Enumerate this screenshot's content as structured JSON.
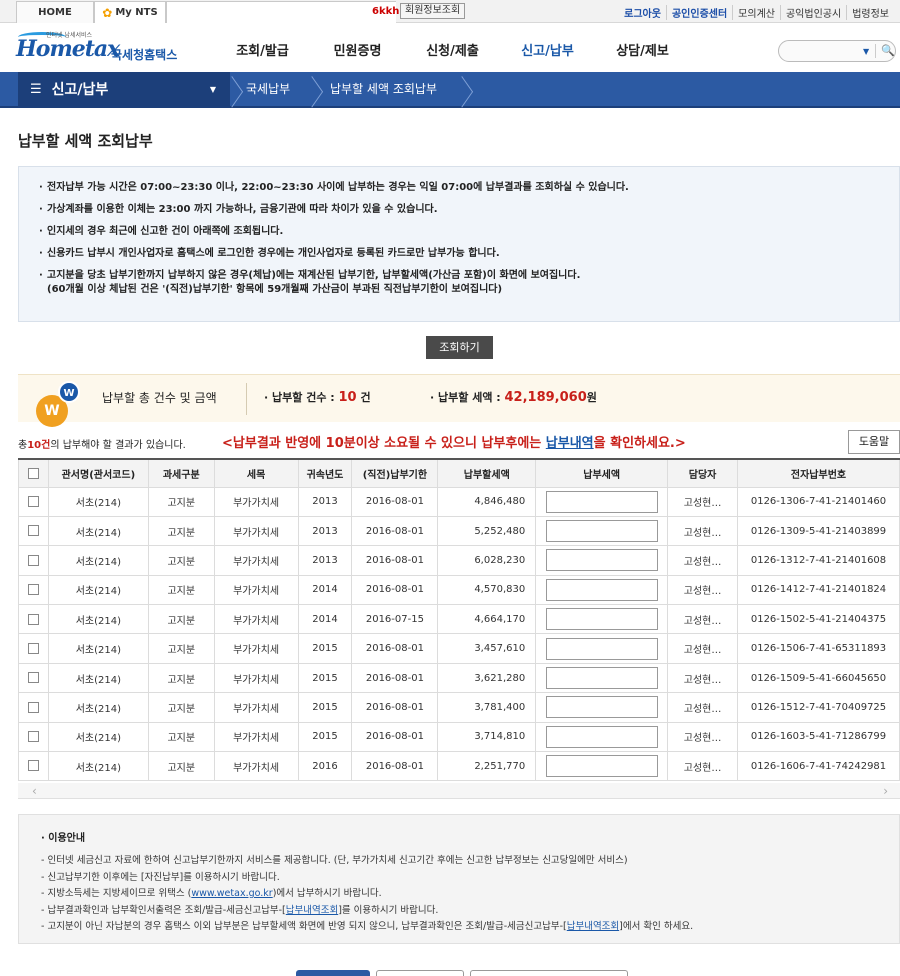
{
  "topbar": {
    "home": "HOME",
    "mynts": "My NTS",
    "user_suffix": "6kkh",
    "member_info": "회원정보조회",
    "links": [
      "로그아웃",
      "공인인증센터",
      "모의계산",
      "공익법인공시",
      "법령정보"
    ]
  },
  "header": {
    "logo_small": "인터넷 납세서비스",
    "logo_main": "Hometax",
    "logo_sub": "국세청홈택스",
    "nav": [
      "조회/발급",
      "민원증명",
      "신청/제출",
      "신고/납부",
      "상담/제보"
    ]
  },
  "breadcrumb": {
    "menu": "신고/납부",
    "items": [
      "국세납부",
      "납부할 세액 조회납부"
    ]
  },
  "page_title": "납부할 세액 조회납부",
  "notice": [
    "전자납부 가능 시간은 07:00~23:30 이나, 22:00~23:30 사이에 납부하는 경우는 익일 07:00에 납부결과를 조회하실 수 있습니다.",
    "가상계좌를 이용한 이체는 23:00 까지 가능하나, 금융기관에 따라 차이가 있을 수 있습니다.",
    "인지세의 경우 최근에 신고한 건이 아래쪽에 조회됩니다.",
    "신용카드 납부시 개인사업자로 홈택스에 로그인한 경우에는 개인사업자로 등록된 카드로만 납부가능 합니다.",
    "고지분을 당초 납부기한까지 납부하지 않은 경우(체납)에는 재계산된 납부기한, 납부할세액(가산금 포함)이 화면에 보여집니다."
  ],
  "notice_line2": "(60개월 이상 체납된 건은 '(직전)납부기한' 항목에 59개월째 가산금이 부과된 직전납부기한이 보여집니다)",
  "query_button": "조회하기",
  "summary": {
    "badge1": "W",
    "badge2": "W",
    "title": "납부할 총 건수 및 금액",
    "count_label": "납부할 건수 : ",
    "count_value": "10",
    "count_unit": " 건",
    "amount_label": "납부할 세액 : ",
    "amount_value": "42,189,060",
    "amount_unit": "원"
  },
  "result": {
    "prefix": "총",
    "count": "10건",
    "suffix": "의 납부해야 할 결과가 있습니다.",
    "warn_a": "<납부결과 반영에 10분이상 소요될 수 있으니 납부후에는 ",
    "warn_link": "납부내역",
    "warn_b": "을 확인하세요.>",
    "help": "도움말"
  },
  "table": {
    "headers": [
      "관서명(관서코드)",
      "과세구분",
      "세목",
      "귀속년도",
      "(직전)납부기한",
      "납부할세액",
      "납부세액",
      "담당자",
      "전자납부번호"
    ],
    "rows": [
      [
        "서초(214)",
        "고지분",
        "부가가치세",
        "2013",
        "2016-08-01",
        "4,846,480",
        "고성현…",
        "0126-1306-7-41-21401460"
      ],
      [
        "서초(214)",
        "고지분",
        "부가가치세",
        "2013",
        "2016-08-01",
        "5,252,480",
        "고성현…",
        "0126-1309-5-41-21403899"
      ],
      [
        "서초(214)",
        "고지분",
        "부가가치세",
        "2013",
        "2016-08-01",
        "6,028,230",
        "고성현…",
        "0126-1312-7-41-21401608"
      ],
      [
        "서초(214)",
        "고지분",
        "부가가치세",
        "2014",
        "2016-08-01",
        "4,570,830",
        "고성현…",
        "0126-1412-7-41-21401824"
      ],
      [
        "서초(214)",
        "고지분",
        "부가가치세",
        "2014",
        "2016-07-15",
        "4,664,170",
        "고성현…",
        "0126-1502-5-41-21404375"
      ],
      [
        "서초(214)",
        "고지분",
        "부가가치세",
        "2015",
        "2016-08-01",
        "3,457,610",
        "고성현…",
        "0126-1506-7-41-65311893"
      ],
      [
        "서초(214)",
        "고지분",
        "부가가치세",
        "2015",
        "2016-08-01",
        "3,621,280",
        "고성현…",
        "0126-1509-5-41-66045650"
      ],
      [
        "서초(214)",
        "고지분",
        "부가가치세",
        "2015",
        "2016-08-01",
        "3,781,400",
        "고성현…",
        "0126-1512-7-41-70409725"
      ],
      [
        "서초(214)",
        "고지분",
        "부가가치세",
        "2015",
        "2016-08-01",
        "3,714,810",
        "고성현…",
        "0126-1603-5-41-71286799"
      ],
      [
        "서초(214)",
        "고지분",
        "부가가치세",
        "2016",
        "2016-08-01",
        "2,251,770",
        "고성현…",
        "0126-1606-7-41-74242981"
      ]
    ]
  },
  "guide": {
    "title": "이용안내",
    "items": [
      {
        "a": "- 인터넷 세금신고 자료에 한하여 신고납부기한까지 서비스를 제공합니다. (단, 부가가치세 신고기간 후에는 신고한 납부정보는 신고당일에만 서비스)",
        "link": "",
        "b": ""
      },
      {
        "a": "- 신고납부기한 이후에는 [자진납부]를 이용하시기 바랍니다.",
        "link": "",
        "b": ""
      },
      {
        "a": "- 지방소득세는 지방세이므로 위택스 (",
        "link": "www.wetax.go.kr",
        "b": ")에서 납부하시기 바랍니다."
      },
      {
        "a": "- 납부결과확인과 납부확인서출력은 조회/발급-세금신고납부-[",
        "link": "납부내역조회",
        "b": "]를 이용하시기 바랍니다."
      },
      {
        "a": "- 고지분이 아닌 자납분의 경우 홈택스 이외 납부분은 납부할세액 화면에 반영 되지 않으니, 납부결과확인은 조회/발급-세금신고납부-[",
        "link": "납부내역조회",
        "b": "]에서 확인 하세요."
      }
    ]
  }
}
